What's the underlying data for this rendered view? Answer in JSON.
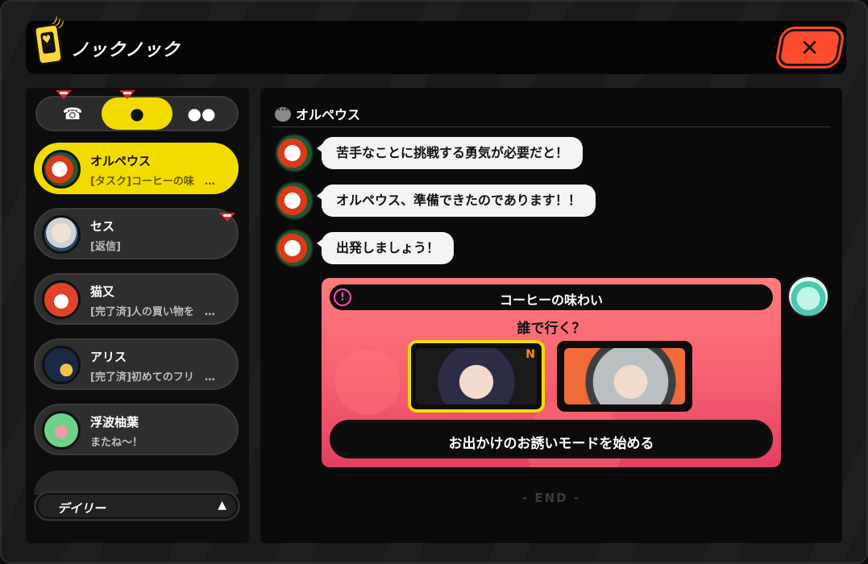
{
  "header": {
    "title": "ノックノック"
  },
  "tabs": {
    "items": [
      {
        "icon": "phone-book-icon"
      },
      {
        "icon": "person-icon"
      },
      {
        "icon": "group-icon"
      }
    ]
  },
  "contacts": [
    {
      "name": "オルペウス",
      "preview": "[タスク]コーヒーの味　…"
    },
    {
      "name": "セス",
      "preview": "[返信]"
    },
    {
      "name": "猫又",
      "preview": "[完了済]人の買い物を　…"
    },
    {
      "name": "アリス",
      "preview": "[完了済]初めてのフリ　…"
    },
    {
      "name": "浮波柚葉",
      "preview": "またね～！"
    }
  ],
  "footer": {
    "daily_label": "デイリー",
    "arrow": "▲"
  },
  "chat": {
    "header": "オルペウス",
    "messages": [
      "苦手なことに挑戦する勇気が必要だと！",
      "オルペウス、準備できたのであります！！",
      "出発しましょう！"
    ],
    "task_card": {
      "icon_glyph": "!",
      "title": "コーヒーの味わい",
      "question": "誰で行く？",
      "badge": "N",
      "start_label": "お出かけのお誘いモードを始める"
    },
    "end_label": "- END -"
  },
  "colors": {
    "accent_yellow": "#f2dc00",
    "close_red": "#ff4a2e",
    "card_pink": "#f56070",
    "badge_red": "#e8222b"
  }
}
